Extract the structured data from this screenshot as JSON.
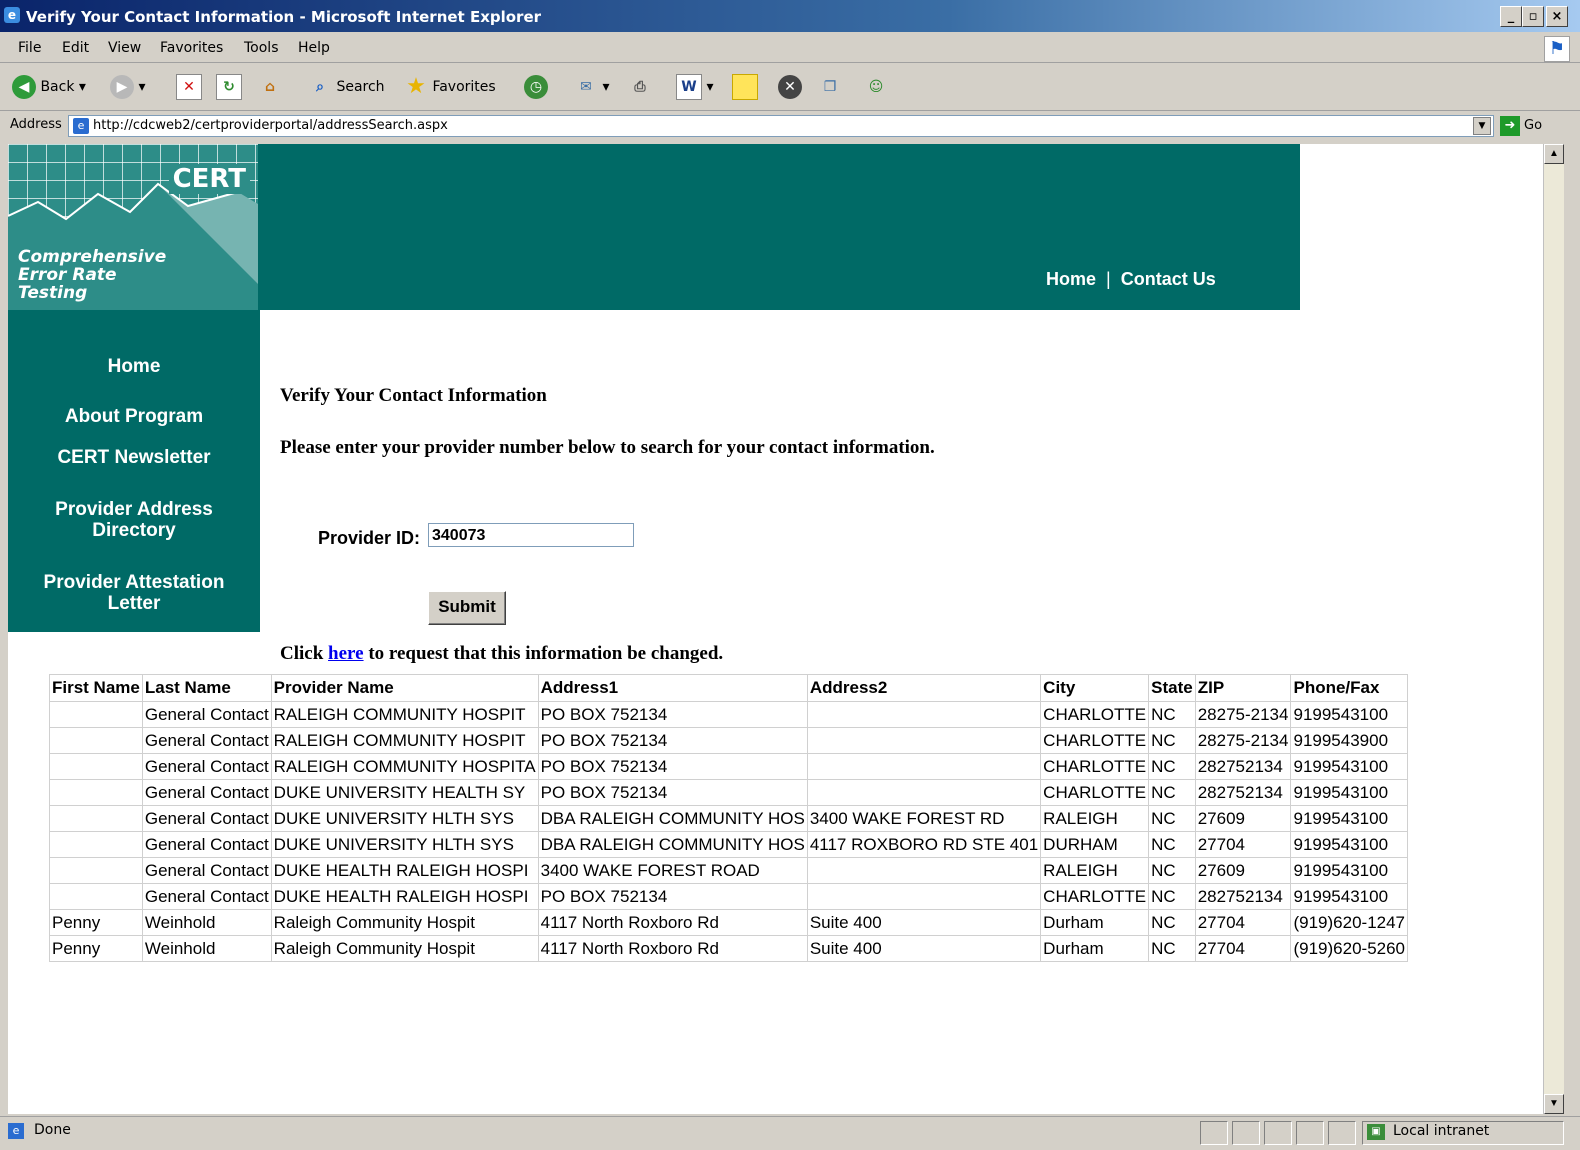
{
  "window": {
    "title": "Verify Your Contact Information - Microsoft Internet Explorer"
  },
  "menu": [
    "File",
    "Edit",
    "View",
    "Favorites",
    "Tools",
    "Help"
  ],
  "toolbar": {
    "back": "Back",
    "search": "Search",
    "favorites": "Favorites"
  },
  "address": {
    "label": "Address",
    "url": "http://cdcweb2/certproviderportal/addressSearch.aspx",
    "go": "Go"
  },
  "logo": {
    "name": "CERT",
    "line1": "Comprehensive",
    "line2": "Error Rate",
    "line3": "Testing"
  },
  "topnav": {
    "home": "Home",
    "sep": "|",
    "contact": "Contact Us"
  },
  "sidenav": [
    {
      "line1": "Home",
      "line2": ""
    },
    {
      "line1": "About Program",
      "line2": ""
    },
    {
      "line1": "CERT Newsletter",
      "line2": ""
    },
    {
      "line1": "Provider Address",
      "line2": "Directory"
    },
    {
      "line1": "Provider Attestation",
      "line2": "Letter"
    }
  ],
  "main": {
    "heading": "Verify Your Contact Information",
    "instruction": "Please enter your provider number below to search for your contact information.",
    "provider_label": "Provider ID:",
    "provider_value": "340073",
    "submit": "Submit",
    "click_pre": "Click",
    "click_link": "here",
    "click_post": "to request that this information be changed."
  },
  "table": {
    "headers": [
      "First Name",
      "Last Name",
      "Provider Name",
      "Address1",
      "Address2",
      "City",
      "State",
      "ZIP",
      "Phone/Fax"
    ],
    "rows": [
      [
        "",
        "General Contact",
        "RALEIGH COMMUNITY HOSPIT",
        "PO BOX 752134",
        "",
        "CHARLOTTE",
        "NC",
        "28275-2134",
        "9199543100"
      ],
      [
        "",
        "General Contact",
        "RALEIGH COMMUNITY HOSPIT",
        "PO BOX 752134",
        "",
        "CHARLOTTE",
        "NC",
        "28275-2134",
        "9199543900"
      ],
      [
        "",
        "General Contact",
        "RALEIGH COMMUNITY HOSPITA",
        "PO BOX 752134",
        "",
        "CHARLOTTE",
        "NC",
        "282752134",
        "9199543100"
      ],
      [
        "",
        "General Contact",
        "DUKE UNIVERSITY HEALTH SY",
        "PO BOX 752134",
        "",
        "CHARLOTTE",
        "NC",
        "282752134",
        "9199543100"
      ],
      [
        "",
        "General Contact",
        "DUKE UNIVERSITY HLTH SYS",
        "DBA RALEIGH COMMUNITY HOS",
        "3400 WAKE FOREST RD",
        "RALEIGH",
        "NC",
        "27609",
        "9199543100"
      ],
      [
        "",
        "General Contact",
        "DUKE UNIVERSITY HLTH SYS",
        "DBA RALEIGH COMMUNITY HOS",
        "4117 ROXBORO RD STE 401",
        "DURHAM",
        "NC",
        "27704",
        "9199543100"
      ],
      [
        "",
        "General Contact",
        "DUKE HEALTH RALEIGH HOSPI",
        "3400 WAKE FOREST ROAD",
        "",
        "RALEIGH",
        "NC",
        "27609",
        "9199543100"
      ],
      [
        "",
        "General Contact",
        "DUKE HEALTH RALEIGH HOSPI",
        "PO BOX 752134",
        "",
        "CHARLOTTE",
        "NC",
        "282752134",
        "9199543100"
      ],
      [
        "Penny",
        "Weinhold",
        "Raleigh Community Hospit",
        "4117 North Roxboro Rd",
        "Suite 400",
        "Durham",
        "NC",
        "27704",
        "(919)620-1247"
      ],
      [
        "Penny",
        "Weinhold",
        "Raleigh Community Hospit",
        "4117 North Roxboro Rd",
        "Suite 400",
        "Durham",
        "NC",
        "27704",
        "(919)620-5260"
      ]
    ]
  },
  "status": {
    "text": "Done",
    "zone": "Local intranet"
  },
  "colors": {
    "teal": "#006a66",
    "link": "#0000ee"
  }
}
